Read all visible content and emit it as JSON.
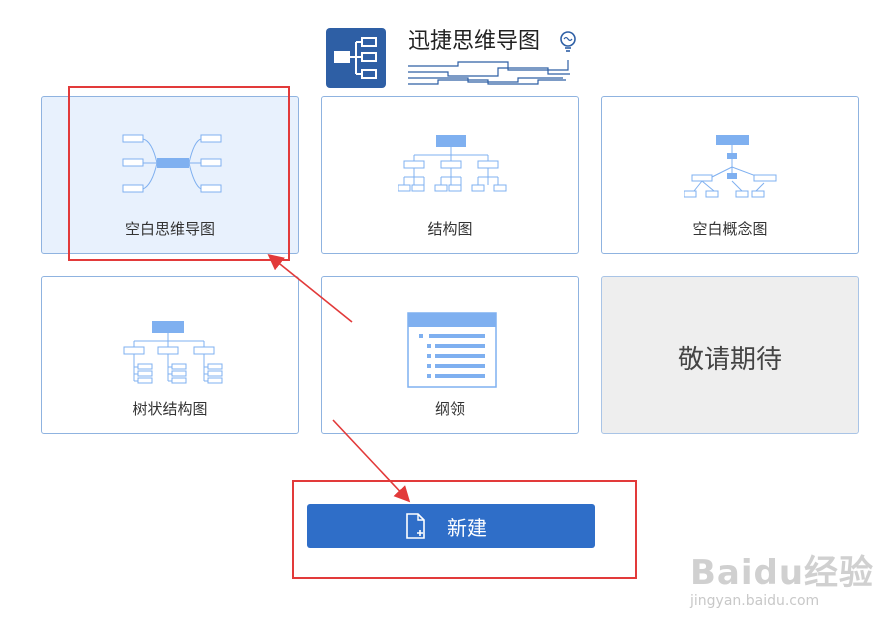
{
  "header": {
    "app_title": "迅捷思维导图"
  },
  "templates": [
    {
      "label": "空白思维导图",
      "selected": true
    },
    {
      "label": "结构图",
      "selected": false
    },
    {
      "label": "空白概念图",
      "selected": false
    },
    {
      "label": "树状结构图",
      "selected": false
    },
    {
      "label": "纲领",
      "selected": false
    },
    {
      "label": "敬请期待",
      "selected": false
    }
  ],
  "new_button": {
    "label": "新建",
    "icon": "new-file-icon"
  },
  "watermark": {
    "brand": "Baidu经验",
    "sub": "jingyan.baidu.com"
  },
  "colors": {
    "accent": "#2f6ec8",
    "logo": "#2e5fa5",
    "card_border": "#8fb3e0",
    "selected_bg": "#e8f1fd",
    "annotation": "#e23a3a",
    "thumb_blue": "#7fb0f0"
  }
}
